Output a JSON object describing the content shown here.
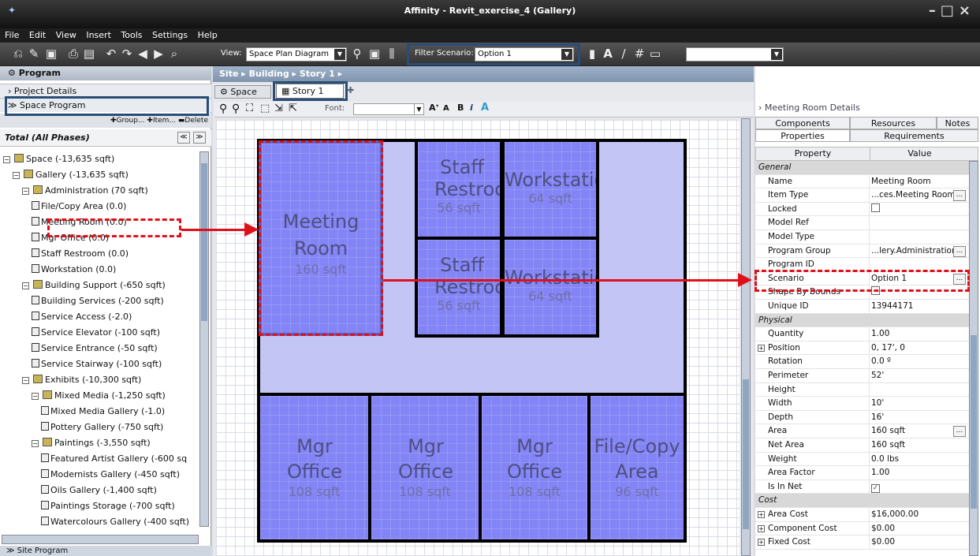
{
  "window": {
    "title": "Affinity - Revit_exercise_4 (Gallery)"
  },
  "menu": [
    "File",
    "Edit",
    "View",
    "Insert",
    "Tools",
    "Settings",
    "Help"
  ],
  "toolbar": {
    "view_label": "View:",
    "view_value": "Space Plan Diagram",
    "filter_label": "Filter Scenario:",
    "filter_value": "Option 1"
  },
  "left": {
    "program_title": "Program",
    "project_details": "Project Details",
    "space_program": "Space Program",
    "actions": {
      "group": "Group...",
      "item": "Item...",
      "delete": "Delete"
    },
    "total_label": "Total (All Phases)",
    "site_program": "Site Program",
    "tree": [
      {
        "label": "Space (-13,635 sqft)",
        "level": 0,
        "folder": true,
        "exp": "−"
      },
      {
        "label": "Gallery (-13,635 sqft)",
        "level": 1,
        "folder": true,
        "exp": "−"
      },
      {
        "label": "Administration (70 sqft)",
        "level": 2,
        "folder": true,
        "exp": "−"
      },
      {
        "label": "File/Copy Area  (0.0)",
        "level": 3
      },
      {
        "label": "Meeting Room  (0.0)",
        "level": 3
      },
      {
        "label": "Mgr Office  (0.0)",
        "level": 3
      },
      {
        "label": "Staff Restroom  (0.0)",
        "level": 3
      },
      {
        "label": "Workstation  (0.0)",
        "level": 3
      },
      {
        "label": "Building Support (-650 sqft)",
        "level": 2,
        "folder": true,
        "exp": "−"
      },
      {
        "label": "Building Services  (-200 sqft)",
        "level": 3
      },
      {
        "label": "Service Access  (-2.0)",
        "level": 3
      },
      {
        "label": "Service Elevator  (-100 sqft)",
        "level": 3
      },
      {
        "label": "Service Entrance  (-50 sqft)",
        "level": 3
      },
      {
        "label": "Service Stairway  (-100 sqft)",
        "level": 3
      },
      {
        "label": "Exhibits (-10,300 sqft)",
        "level": 2,
        "folder": true,
        "exp": "−"
      },
      {
        "label": "Mixed Media (-1,250 sqft)",
        "level": 3,
        "folder": true,
        "exp": "−"
      },
      {
        "label": "Mixed Media Gallery  (-1.0)",
        "level": 4
      },
      {
        "label": "Pottery Gallery  (-750 sqft)",
        "level": 4
      },
      {
        "label": "Paintings (-3,550 sqft)",
        "level": 3,
        "folder": true,
        "exp": "−"
      },
      {
        "label": "Featured Artist Gallery  (-600 sq",
        "level": 4
      },
      {
        "label": "Modernists Gallery  (-450 sqft)",
        "level": 4
      },
      {
        "label": "Oils Gallery  (-1,400 sqft)",
        "level": 4
      },
      {
        "label": "Paintings Storage  (-700 sqft)",
        "level": 4
      },
      {
        "label": "Watercolours Gallery  (-400 sqft)",
        "level": 4
      }
    ]
  },
  "center": {
    "breadcrumb": [
      "Site",
      "Building",
      "Story 1"
    ],
    "tabs": [
      "Space",
      "Story 1"
    ],
    "font_label": "Font:",
    "rooms": [
      {
        "name": "Meeting Room",
        "area": "160 sqft"
      },
      {
        "name": "Staff Restroom",
        "area": "56 sqft"
      },
      {
        "name": "Workstation",
        "area": "64 sqft"
      },
      {
        "name": "Staff Restroom",
        "area": "56 sqft"
      },
      {
        "name": "Workstation",
        "area": "64 sqft"
      },
      {
        "name": "Mgr Office",
        "area": "108 sqft"
      },
      {
        "name": "Mgr Office",
        "area": "108 sqft"
      },
      {
        "name": "Mgr Office",
        "area": "108 sqft"
      },
      {
        "name": "File/Copy Area",
        "area": "96 sqft"
      }
    ]
  },
  "right": {
    "title": "Meeting Room Details",
    "tabs_row1": [
      "Components",
      "Resources",
      "Notes"
    ],
    "tabs_row2": [
      "Properties",
      "Requirements"
    ],
    "col_property": "Property",
    "col_value": "Value",
    "rows": [
      {
        "k": "General",
        "section": true
      },
      {
        "k": "Name",
        "v": "Meeting Room"
      },
      {
        "k": "Item Type",
        "v": "...ces.Meeting Room",
        "ellipsis": true
      },
      {
        "k": "Locked",
        "check": false
      },
      {
        "k": "Model Ref",
        "v": ""
      },
      {
        "k": "Model Type",
        "v": ""
      },
      {
        "k": "Program Group",
        "v": "...lery.Administration",
        "ellipsis": true
      },
      {
        "k": "Program ID",
        "v": ""
      },
      {
        "k": "Scenario",
        "v": "Option 1",
        "ellipsis": true
      },
      {
        "k": "Shape By Bounds",
        "check": false
      },
      {
        "k": "Unique ID",
        "v": "13944171"
      },
      {
        "k": "Physical",
        "section": true
      },
      {
        "k": "Quantity",
        "v": "1.00"
      },
      {
        "k": "Position",
        "v": "0, 17', 0",
        "exp": true
      },
      {
        "k": "Rotation",
        "v": "0.0 º"
      },
      {
        "k": "Perimeter",
        "v": "52'"
      },
      {
        "k": "Height",
        "v": ""
      },
      {
        "k": "Width",
        "v": "10'"
      },
      {
        "k": "Depth",
        "v": "16'"
      },
      {
        "k": "Area",
        "v": "160 sqft",
        "ellipsis": true
      },
      {
        "k": "Net Area",
        "v": "160 sqft"
      },
      {
        "k": "Weight",
        "v": "0.0 lbs"
      },
      {
        "k": "Area Factor",
        "v": "1.00"
      },
      {
        "k": "Is In Net",
        "check": true
      },
      {
        "k": "Cost",
        "section": true
      },
      {
        "k": "Area Cost",
        "v": "$16,000.00",
        "exp": true
      },
      {
        "k": "Component Cost",
        "v": "$0.00",
        "exp": true
      },
      {
        "k": "Fixed Cost",
        "v": "$0.00",
        "exp": true
      }
    ]
  }
}
